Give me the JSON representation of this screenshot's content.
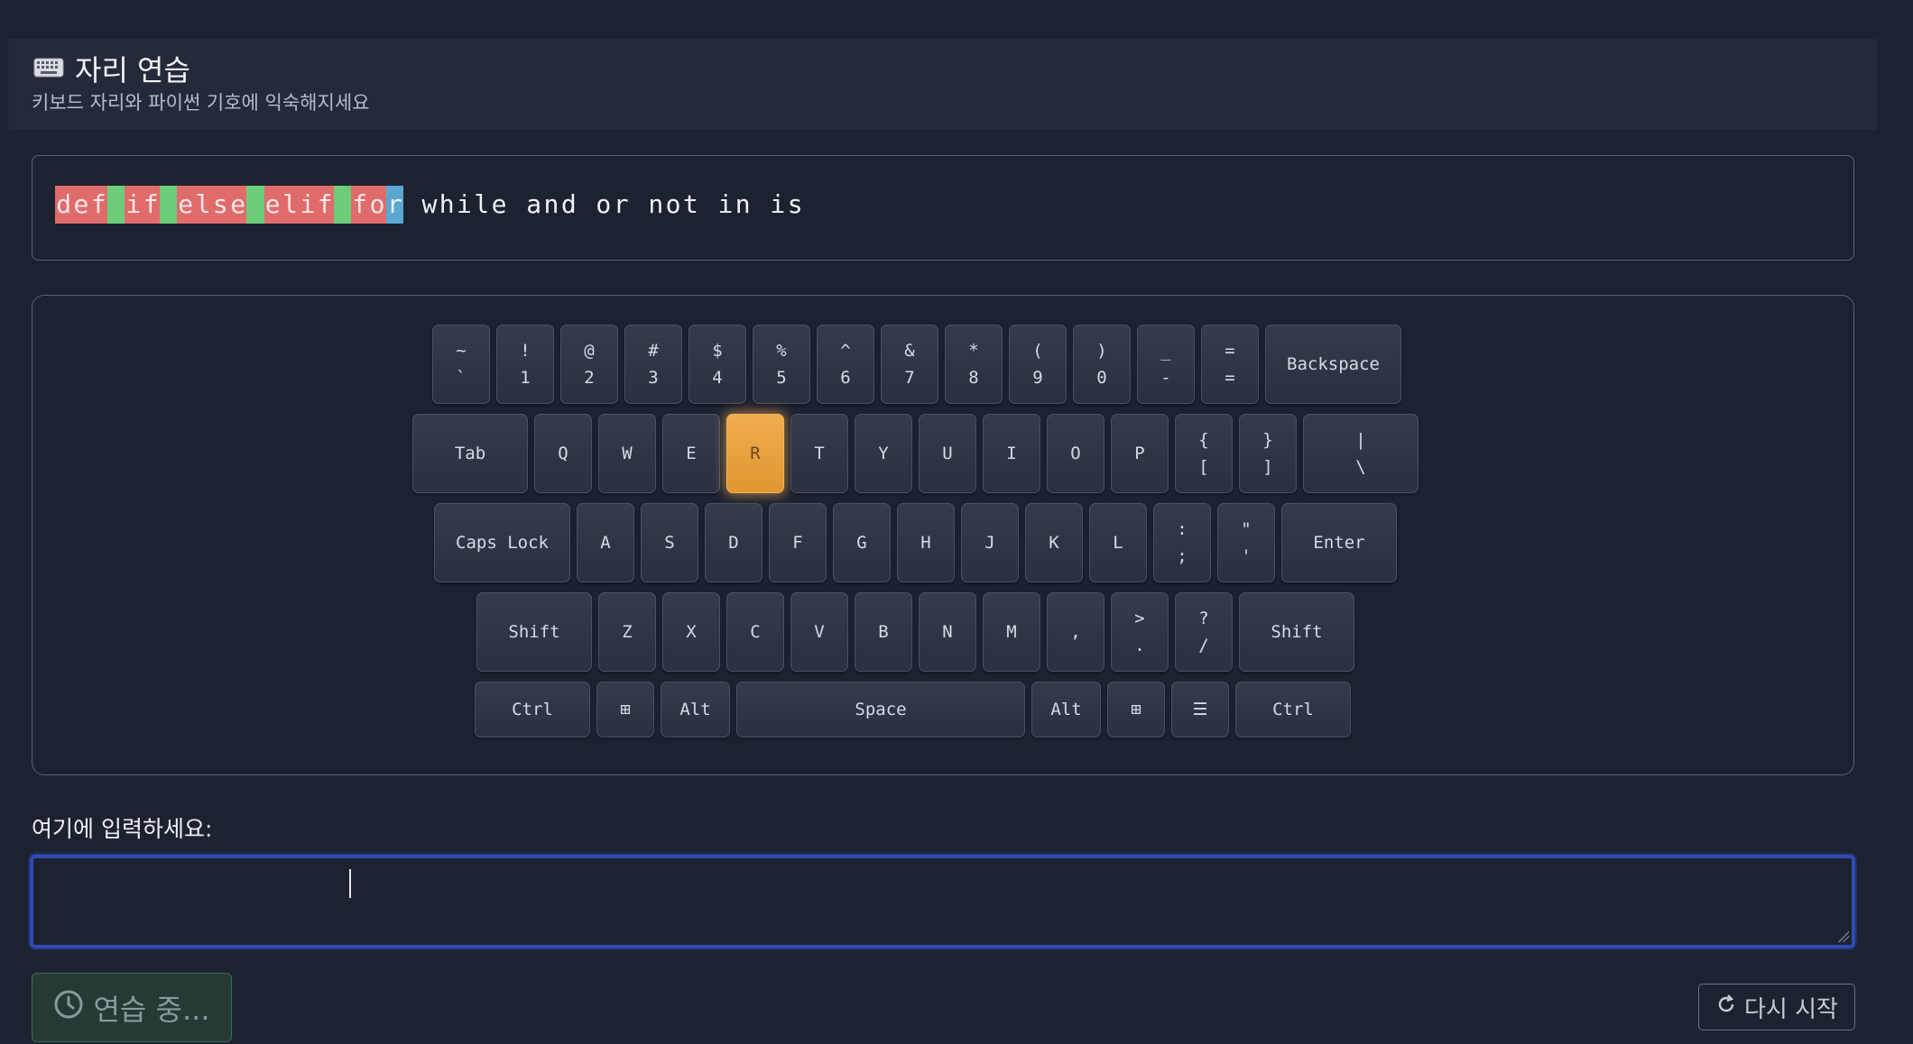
{
  "header": {
    "icon": "keyboard-icon",
    "title": "자리 연습",
    "subtitle": "키보드 자리와 파이썬 기호에 익숙해지세요"
  },
  "target": {
    "chars": [
      {
        "c": "d",
        "s": "wrong"
      },
      {
        "c": "e",
        "s": "wrong"
      },
      {
        "c": "f",
        "s": "wrong"
      },
      {
        "c": " ",
        "s": "right"
      },
      {
        "c": "i",
        "s": "wrong"
      },
      {
        "c": "f",
        "s": "wrong"
      },
      {
        "c": " ",
        "s": "right"
      },
      {
        "c": "e",
        "s": "wrong"
      },
      {
        "c": "l",
        "s": "wrong"
      },
      {
        "c": "s",
        "s": "wrong"
      },
      {
        "c": "e",
        "s": "wrong"
      },
      {
        "c": " ",
        "s": "right"
      },
      {
        "c": "e",
        "s": "wrong"
      },
      {
        "c": "l",
        "s": "wrong"
      },
      {
        "c": "i",
        "s": "wrong"
      },
      {
        "c": "f",
        "s": "wrong"
      },
      {
        "c": " ",
        "s": "right"
      },
      {
        "c": "f",
        "s": "wrong"
      },
      {
        "c": "o",
        "s": "wrong"
      },
      {
        "c": "r",
        "s": "cur"
      },
      {
        "c": " ",
        "s": "pending"
      },
      {
        "c": "w",
        "s": "pending"
      },
      {
        "c": "h",
        "s": "pending"
      },
      {
        "c": "i",
        "s": "pending"
      },
      {
        "c": "l",
        "s": "pending"
      },
      {
        "c": "e",
        "s": "pending"
      },
      {
        "c": " ",
        "s": "pending"
      },
      {
        "c": "a",
        "s": "pending"
      },
      {
        "c": "n",
        "s": "pending"
      },
      {
        "c": "d",
        "s": "pending"
      },
      {
        "c": " ",
        "s": "pending"
      },
      {
        "c": "o",
        "s": "pending"
      },
      {
        "c": "r",
        "s": "pending"
      },
      {
        "c": " ",
        "s": "pending"
      },
      {
        "c": "n",
        "s": "pending"
      },
      {
        "c": "o",
        "s": "pending"
      },
      {
        "c": "t",
        "s": "pending"
      },
      {
        "c": " ",
        "s": "pending"
      },
      {
        "c": "i",
        "s": "pending"
      },
      {
        "c": "n",
        "s": "pending"
      },
      {
        "c": " ",
        "s": "pending"
      },
      {
        "c": "i",
        "s": "pending"
      },
      {
        "c": "s",
        "s": "pending"
      }
    ]
  },
  "keyboard": {
    "active_key": "R",
    "rows": [
      [
        [
          "~",
          "`"
        ],
        [
          "!",
          "1"
        ],
        [
          "@",
          "2"
        ],
        [
          "#",
          "3"
        ],
        [
          "$",
          "4"
        ],
        [
          "%",
          "5"
        ],
        [
          "^",
          "6"
        ],
        [
          "&",
          "7"
        ],
        [
          "*",
          "8"
        ],
        [
          "(",
          "9"
        ],
        [
          ")",
          "0"
        ],
        [
          "_",
          "-"
        ],
        [
          "=",
          "="
        ],
        [
          "",
          "Backspace"
        ]
      ],
      [
        [
          "",
          "Tab"
        ],
        [
          "",
          "Q"
        ],
        [
          "",
          "W"
        ],
        [
          "",
          "E"
        ],
        [
          "",
          "R"
        ],
        [
          "",
          "T"
        ],
        [
          "",
          "Y"
        ],
        [
          "",
          "U"
        ],
        [
          "",
          "I"
        ],
        [
          "",
          "O"
        ],
        [
          "",
          "P"
        ],
        [
          "{",
          "["
        ],
        [
          "}",
          "]"
        ],
        [
          "|",
          "\\"
        ]
      ],
      [
        [
          "",
          "Caps Lock"
        ],
        [
          "",
          "A"
        ],
        [
          "",
          "S"
        ],
        [
          "",
          "D"
        ],
        [
          "",
          "F"
        ],
        [
          "",
          "G"
        ],
        [
          "",
          "H"
        ],
        [
          "",
          "J"
        ],
        [
          "",
          "K"
        ],
        [
          "",
          "L"
        ],
        [
          ":",
          ";"
        ],
        [
          "\"",
          "'"
        ],
        [
          "",
          "Enter"
        ]
      ],
      [
        [
          "",
          "Shift"
        ],
        [
          "",
          "Z"
        ],
        [
          "",
          "X"
        ],
        [
          "",
          "C"
        ],
        [
          "",
          "V"
        ],
        [
          "",
          "B"
        ],
        [
          "",
          "N"
        ],
        [
          "",
          "M"
        ],
        [
          "",
          ","
        ],
        [
          ">",
          "."
        ],
        [
          "?",
          "/"
        ],
        [
          "",
          "Shift"
        ]
      ],
      [
        [
          "",
          "Ctrl"
        ],
        [
          "",
          "⊞"
        ],
        [
          "",
          "Alt"
        ],
        [
          "",
          "Space"
        ],
        [
          "",
          "Alt"
        ],
        [
          "",
          "⊞"
        ],
        [
          "",
          "☰"
        ],
        [
          "",
          "Ctrl"
        ]
      ]
    ]
  },
  "input": {
    "label": "여기에 입력하세요:",
    "value": ""
  },
  "status": {
    "icon": "clock-icon",
    "label": "연습 중..."
  },
  "restart": {
    "icon": "refresh-icon",
    "label": "다시 시작"
  }
}
